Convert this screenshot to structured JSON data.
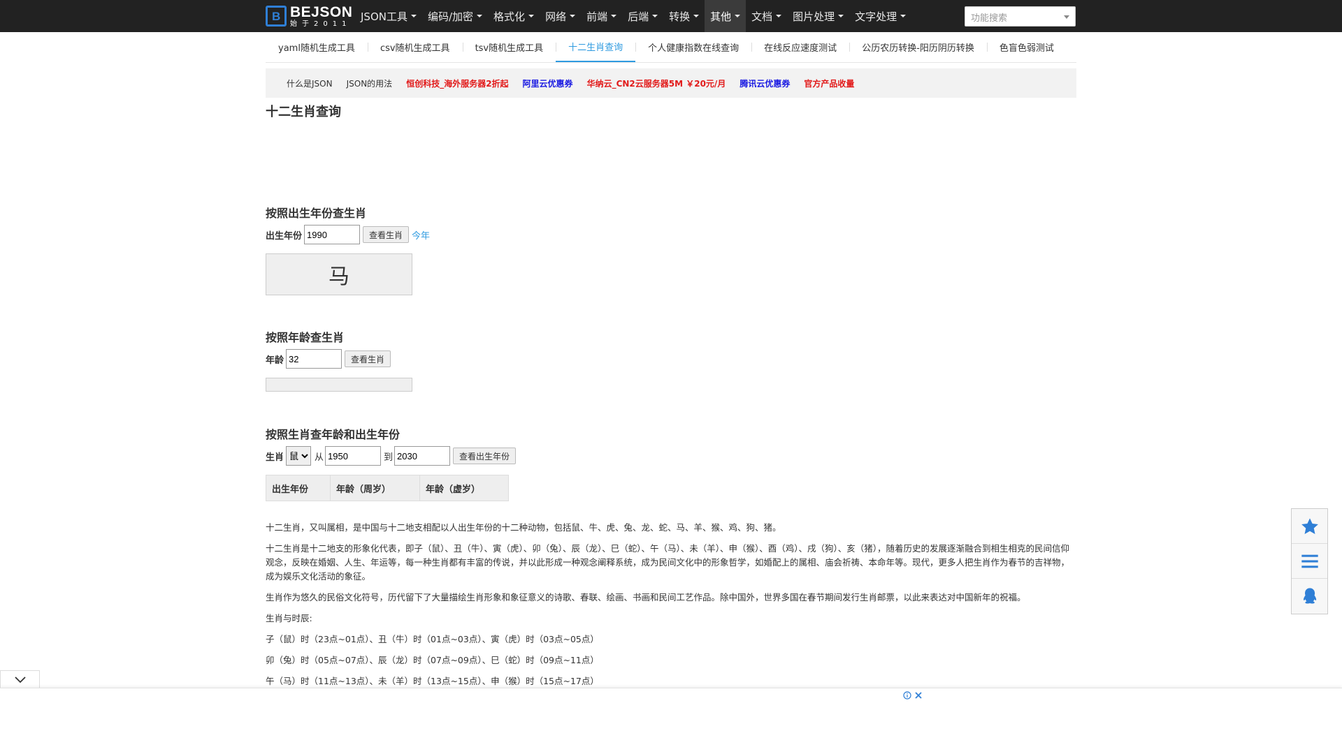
{
  "brand": {
    "name": "BEJSON",
    "subtitle": "始于2011",
    "logo_letter": "B",
    "accent": "#2f7fd6"
  },
  "nav": [
    {
      "label": "JSON工具"
    },
    {
      "label": "编码/加密"
    },
    {
      "label": "格式化"
    },
    {
      "label": "网络"
    },
    {
      "label": "前端"
    },
    {
      "label": "后端"
    },
    {
      "label": "转换"
    },
    {
      "label": "其他",
      "active": true
    },
    {
      "label": "文档"
    },
    {
      "label": "图片处理"
    },
    {
      "label": "文字处理"
    }
  ],
  "search": {
    "placeholder": "功能搜索"
  },
  "tabs": [
    {
      "label": "yaml随机生成工具"
    },
    {
      "label": "csv随机生成工具"
    },
    {
      "label": "tsv随机生成工具"
    },
    {
      "label": "十二生肖查询",
      "active": true
    },
    {
      "label": "个人健康指数在线查询"
    },
    {
      "label": "在线反应速度测试"
    },
    {
      "label": "公历农历转换-阳历阴历转换"
    },
    {
      "label": "色盲色弱测试"
    }
  ],
  "links": [
    {
      "label": "什么是JSON",
      "style": "plain"
    },
    {
      "label": "JSON的用法",
      "style": "plain"
    },
    {
      "label": "恒创科技_海外服务器2折起",
      "style": "red"
    },
    {
      "label": "阿里云优惠券",
      "style": "blue"
    },
    {
      "label": "华纳云_CN2云服务器5M ￥20元/月",
      "style": "red"
    },
    {
      "label": "腾讯云优惠券",
      "style": "blue"
    },
    {
      "label": "官方产品收量",
      "style": "red"
    }
  ],
  "page_title": "十二生肖查询",
  "by_year": {
    "title": "按照出生年份查生肖",
    "label": "出生年份",
    "value": "1990",
    "button": "查看生肖",
    "today_link": "今年",
    "result": "马"
  },
  "by_age": {
    "title": "按照年龄查生肖",
    "label": "年龄",
    "value": "32",
    "button": "查看生肖",
    "result": ""
  },
  "by_zodiac": {
    "title": "按照生肖查年龄和出生年份",
    "label": "生肖",
    "selected": "鼠",
    "from_label": "从",
    "from_value": "1950",
    "to_label": "到",
    "to_value": "2030",
    "button": "查看出生年份",
    "table_headers": [
      "出生年份",
      "年龄（周岁）",
      "年龄（虚岁）"
    ]
  },
  "article": [
    "十二生肖，又叫属相，是中国与十二地支相配以人出生年份的十二种动物，包括鼠、牛、虎、兔、龙、蛇、马、羊、猴、鸡、狗、猪。",
    "十二生肖是十二地支的形象化代表，即子（鼠）、丑（牛）、寅（虎）、卯（兔）、辰（龙）、巳（蛇）、午（马）、未（羊）、申（猴）、酉（鸡）、戌（狗）、亥（猪），随着历史的发展逐渐融合到相生相克的民间信仰观念，反映在婚姻、人生、年运等，每一种生肖都有丰富的传说，并以此形成一种观念阐释系统，成为民间文化中的形象哲学，如婚配上的属相、庙会祈祷、本命年等。现代，更多人把生肖作为春节的吉祥物，成为娱乐文化活动的象征。",
    "生肖作为悠久的民俗文化符号，历代留下了大量描绘生肖形象和象征意义的诗歌、春联、绘画、书画和民间工艺作品。除中国外，世界多国在春节期间发行生肖邮票，以此来表达对中国新年的祝福。",
    "生肖与时辰:",
    "子（鼠）时（23点~01点）、丑（牛）时（01点~03点）、寅（虎）时（03点~05点）",
    "卯（兔）时（05点~07点）、辰（龙）时（07点~09点）、巳（蛇）时（09点~11点）",
    "午（马）时（11点~13点）、未（羊）时（13点~15点）、申（猴）时（15点~17点）"
  ],
  "float_bar": {
    "icons": [
      "star-icon",
      "menu-icon",
      "qq-icon"
    ],
    "color": "#2f7fd6"
  }
}
